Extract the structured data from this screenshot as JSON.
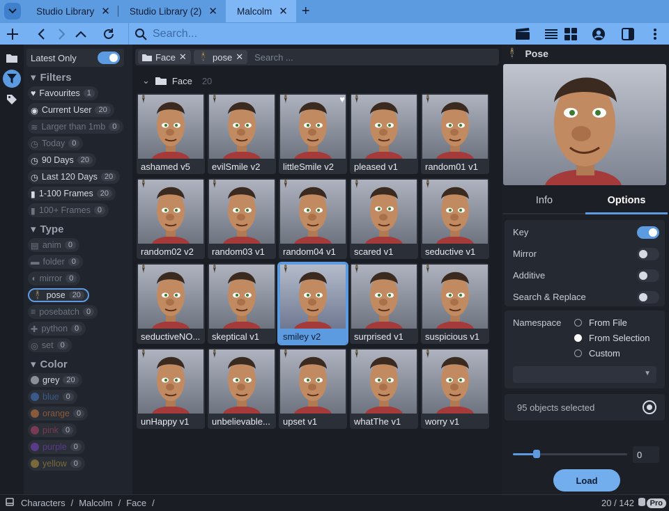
{
  "tabs": [
    {
      "label": "Studio Library"
    },
    {
      "label": "Studio Library (2)"
    },
    {
      "label": "Malcolm"
    }
  ],
  "search": {
    "placeholder": "Search..."
  },
  "filters": {
    "latest_only": "Latest Only",
    "filters_title": "Filters",
    "type_title": "Type",
    "color_title": "Color",
    "filter_items": [
      {
        "label": "Favourites",
        "count": "1",
        "dim": false
      },
      {
        "label": "Current User",
        "count": "20",
        "dim": false
      },
      {
        "label": "Larger than 1mb",
        "count": "0",
        "dim": true
      },
      {
        "label": "Today",
        "count": "0",
        "dim": true
      },
      {
        "label": "90 Days",
        "count": "20",
        "dim": false
      },
      {
        "label": "Last 120 Days",
        "count": "20",
        "dim": false
      },
      {
        "label": "1-100 Frames",
        "count": "20",
        "dim": false
      },
      {
        "label": "100+ Frames",
        "count": "0",
        "dim": true
      }
    ],
    "type_items": [
      {
        "label": "anim",
        "count": "0"
      },
      {
        "label": "folder",
        "count": "0"
      },
      {
        "label": "mirror",
        "count": "0"
      },
      {
        "label": "pose",
        "count": "20"
      },
      {
        "label": "posebatch",
        "count": "0"
      },
      {
        "label": "python",
        "count": "0"
      },
      {
        "label": "set",
        "count": "0"
      }
    ],
    "color_items": [
      {
        "label": "grey",
        "count": "20",
        "color": "#8a8f99"
      },
      {
        "label": "blue",
        "count": "0",
        "color": "#3a5a8a"
      },
      {
        "label": "orange",
        "count": "0",
        "color": "#8a5a3a"
      },
      {
        "label": "pink",
        "count": "0",
        "color": "#7a3a55"
      },
      {
        "label": "purple",
        "count": "0",
        "color": "#5a3a8a"
      },
      {
        "label": "yellow",
        "count": "0",
        "color": "#7a6a3a"
      }
    ]
  },
  "tagbar": {
    "tag1": "Face",
    "tag2": "pose",
    "placeholder": "Search ..."
  },
  "group": {
    "name": "Face",
    "count": "20"
  },
  "items": [
    {
      "label": "ashamed  v5",
      "fav": false
    },
    {
      "label": "evilSmile  v2",
      "fav": false
    },
    {
      "label": "littleSmile  v2",
      "fav": true
    },
    {
      "label": "pleased  v1",
      "fav": false
    },
    {
      "label": "random01  v1",
      "fav": false
    },
    {
      "label": "random02  v2",
      "fav": false
    },
    {
      "label": "random03  v1",
      "fav": false
    },
    {
      "label": "random04  v1",
      "fav": false
    },
    {
      "label": "scared  v1",
      "fav": false
    },
    {
      "label": "seductive  v1",
      "fav": false
    },
    {
      "label": "seductiveNO...",
      "fav": false
    },
    {
      "label": "skeptical  v1",
      "fav": false
    },
    {
      "label": "smiley  v2",
      "fav": false
    },
    {
      "label": "surprised  v1",
      "fav": false
    },
    {
      "label": "suspicious  v1",
      "fav": false
    },
    {
      "label": "unHappy  v1",
      "fav": false
    },
    {
      "label": "unbelievable...",
      "fav": false
    },
    {
      "label": "upset  v1",
      "fav": false
    },
    {
      "label": "whatThe  v1",
      "fav": false
    },
    {
      "label": "worry  v1",
      "fav": false
    }
  ],
  "detail": {
    "title": "Pose",
    "tab_info": "Info",
    "tab_options": "Options",
    "opt_key": "Key",
    "opt_mirror": "Mirror",
    "opt_additive": "Additive",
    "opt_search": "Search & Replace",
    "namespace": "Namespace",
    "ns_file": "From File",
    "ns_selection": "From Selection",
    "ns_custom": "Custom",
    "selected": "95 objects selected",
    "slider_value": "0",
    "load": "Load"
  },
  "status": {
    "crumb1": "Characters",
    "crumb2": "Malcolm",
    "crumb3": "Face",
    "sep": "/",
    "count": "20 / 142",
    "pro": "Pro"
  },
  "colors": {
    "accent": "#5d9be0",
    "tabbar": "#5d9be0",
    "toolbar": "#75b1f3"
  }
}
